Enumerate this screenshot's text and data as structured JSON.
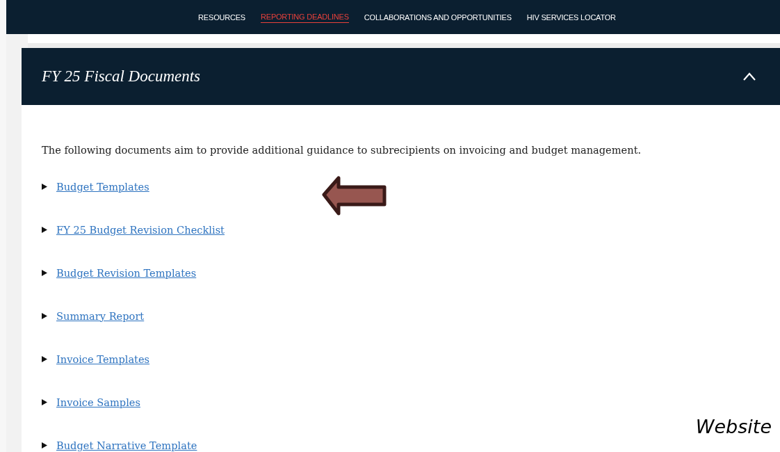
{
  "nav": {
    "items": [
      {
        "label": "RESOURCES",
        "selected": false
      },
      {
        "label": "REPORTING DEADLINES",
        "selected": true
      },
      {
        "label": "COLLABORATIONS AND OPPORTUNITIES",
        "selected": false
      },
      {
        "label": "HIV SERVICES LOCATOR",
        "selected": false
      }
    ]
  },
  "panel": {
    "title": "FY 25 Fiscal Documents",
    "expanded": true,
    "intro": "The following documents aim to provide additional guidance to subrecipients on invoicing and budget management.",
    "links": [
      {
        "label": "Budget Templates"
      },
      {
        "label": "FY 25 Budget Revision Checklist"
      },
      {
        "label": "Budget Revision Templates"
      },
      {
        "label": "Summary Report"
      },
      {
        "label": "Invoice Templates"
      },
      {
        "label": "Invoice Samples"
      },
      {
        "label": "Budget Narrative Template"
      }
    ]
  },
  "annotation": {
    "caption": "Website"
  }
}
